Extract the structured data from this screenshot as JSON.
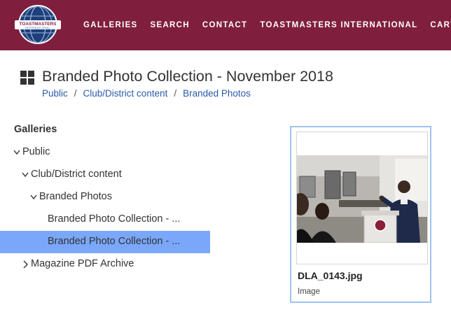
{
  "header": {
    "logo_text_top": "TOASTMASTERS",
    "logo_text_bottom": "INTERNATIONAL",
    "nav": [
      "GALLERIES",
      "SEARCH",
      "CONTACT",
      "TOASTMASTERS INTERNATIONAL",
      "CART"
    ],
    "bg_color": "#7f1f3d"
  },
  "page": {
    "title": "Branded Photo Collection - November 2018",
    "title_icon": "grid-icon",
    "breadcrumb": [
      "Public",
      "Club/District content",
      "Branded Photos"
    ]
  },
  "sidebar": {
    "heading": "Galleries",
    "items": [
      {
        "label": "Public",
        "chevron": "down"
      },
      {
        "label": "Club/District content",
        "chevron": "down"
      },
      {
        "label": "Branded Photos",
        "chevron": "down"
      },
      {
        "label": "Branded Photo Collection - ...",
        "chevron": "none"
      },
      {
        "label": "Branded Photo Collection - ...",
        "chevron": "none",
        "selected": true
      },
      {
        "label": "Magazine PDF Archive",
        "chevron": "right"
      }
    ],
    "selected_color": "#7aa7f9"
  },
  "card": {
    "filename": "DLA_0143.jpg",
    "type": "Image",
    "border_color": "#9ec3ee"
  }
}
